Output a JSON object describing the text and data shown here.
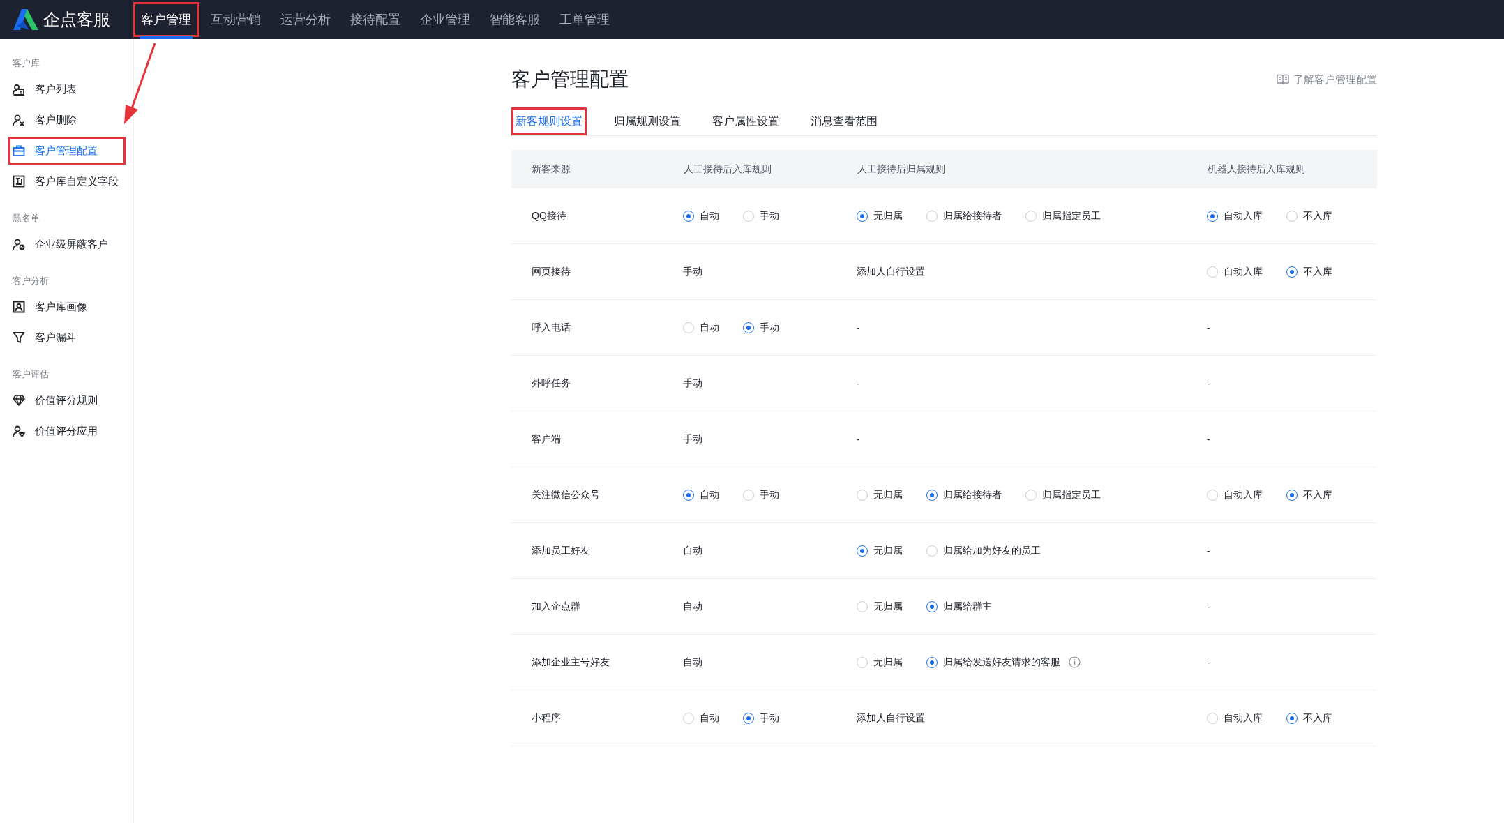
{
  "app": {
    "name": "企点客服"
  },
  "nav": [
    {
      "label": "客户管理",
      "selected": true,
      "annotated": true
    },
    {
      "label": "互动营销",
      "selected": false,
      "annotated": false
    },
    {
      "label": "运营分析",
      "selected": false,
      "annotated": false
    },
    {
      "label": "接待配置",
      "selected": false,
      "annotated": false
    },
    {
      "label": "企业管理",
      "selected": false,
      "annotated": false
    },
    {
      "label": "智能客服",
      "selected": false,
      "annotated": false
    },
    {
      "label": "工单管理",
      "selected": false,
      "annotated": false
    }
  ],
  "sidebar": [
    {
      "heading": "客户库",
      "items": [
        {
          "label": "客户列表",
          "selected": false,
          "annotated": false
        },
        {
          "label": "客户删除",
          "selected": false,
          "annotated": false
        },
        {
          "label": "客户管理配置",
          "selected": true,
          "annotated": true
        },
        {
          "label": "客户库自定义字段",
          "selected": false,
          "annotated": false
        }
      ]
    },
    {
      "heading": "黑名单",
      "items": [
        {
          "label": "企业级屏蔽客户",
          "selected": false,
          "annotated": false
        }
      ]
    },
    {
      "heading": "客户分析",
      "items": [
        {
          "label": "客户库画像",
          "selected": false,
          "annotated": false
        },
        {
          "label": "客户漏斗",
          "selected": false,
          "annotated": false
        }
      ]
    },
    {
      "heading": "客户评估",
      "items": [
        {
          "label": "价值评分规则",
          "selected": false,
          "annotated": false
        },
        {
          "label": "价值评分应用",
          "selected": false,
          "annotated": false
        }
      ]
    }
  ],
  "page": {
    "title": "客户管理配置",
    "help_link": "了解客户管理配置"
  },
  "tabs": [
    {
      "label": "新客规则设置",
      "selected": true,
      "annotated": true
    },
    {
      "label": "归属规则设置",
      "selected": false,
      "annotated": false
    },
    {
      "label": "客户属性设置",
      "selected": false,
      "annotated": false
    },
    {
      "label": "消息查看范围",
      "selected": false,
      "annotated": false
    }
  ],
  "table": {
    "columns": [
      "新客来源",
      "人工接待后入库规则",
      "人工接待后归属规则",
      "机器人接待后入库规则"
    ],
    "rows": [
      {
        "cells": [
          {
            "kind": "text",
            "text": "QQ接待"
          },
          {
            "kind": "radios",
            "options": [
              {
                "label": "自动",
                "selected": true
              },
              {
                "label": "手动",
                "selected": false
              }
            ]
          },
          {
            "kind": "radios",
            "options": [
              {
                "label": "无归属",
                "selected": true
              },
              {
                "label": "归属给接待者",
                "selected": false
              },
              {
                "label": "归属指定员工",
                "selected": false
              }
            ]
          },
          {
            "kind": "radios",
            "options": [
              {
                "label": "自动入库",
                "selected": true
              },
              {
                "label": "不入库",
                "selected": false
              }
            ]
          }
        ]
      },
      {
        "cells": [
          {
            "kind": "text",
            "text": "网页接待"
          },
          {
            "kind": "text",
            "text": "手动"
          },
          {
            "kind": "text",
            "text": "添加人自行设置"
          },
          {
            "kind": "radios",
            "options": [
              {
                "label": "自动入库",
                "selected": false
              },
              {
                "label": "不入库",
                "selected": true
              }
            ]
          }
        ]
      },
      {
        "cells": [
          {
            "kind": "text",
            "text": "呼入电话"
          },
          {
            "kind": "radios",
            "options": [
              {
                "label": "自动",
                "selected": false
              },
              {
                "label": "手动",
                "selected": true
              }
            ]
          },
          {
            "kind": "text",
            "text": "-"
          },
          {
            "kind": "text",
            "text": "-"
          }
        ]
      },
      {
        "cells": [
          {
            "kind": "text",
            "text": "外呼任务"
          },
          {
            "kind": "text",
            "text": "手动"
          },
          {
            "kind": "text",
            "text": "-"
          },
          {
            "kind": "text",
            "text": "-"
          }
        ]
      },
      {
        "cells": [
          {
            "kind": "text",
            "text": "客户端"
          },
          {
            "kind": "text",
            "text": "手动"
          },
          {
            "kind": "text",
            "text": "-"
          },
          {
            "kind": "text",
            "text": "-"
          }
        ]
      },
      {
        "cells": [
          {
            "kind": "text",
            "text": "关注微信公众号"
          },
          {
            "kind": "radios",
            "options": [
              {
                "label": "自动",
                "selected": true
              },
              {
                "label": "手动",
                "selected": false
              }
            ]
          },
          {
            "kind": "radios",
            "options": [
              {
                "label": "无归属",
                "selected": false
              },
              {
                "label": "归属给接待者",
                "selected": true
              },
              {
                "label": "归属指定员工",
                "selected": false
              }
            ]
          },
          {
            "kind": "radios",
            "options": [
              {
                "label": "自动入库",
                "selected": false
              },
              {
                "label": "不入库",
                "selected": true
              }
            ]
          }
        ]
      },
      {
        "cells": [
          {
            "kind": "text",
            "text": "添加员工好友"
          },
          {
            "kind": "text",
            "text": "自动"
          },
          {
            "kind": "radios",
            "options": [
              {
                "label": "无归属",
                "selected": true
              },
              {
                "label": "归属给加为好友的员工",
                "selected": false
              }
            ]
          },
          {
            "kind": "text",
            "text": "-"
          }
        ]
      },
      {
        "cells": [
          {
            "kind": "text",
            "text": "加入企点群"
          },
          {
            "kind": "text",
            "text": "自动"
          },
          {
            "kind": "radios",
            "options": [
              {
                "label": "无归属",
                "selected": false
              },
              {
                "label": "归属给群主",
                "selected": true
              }
            ]
          },
          {
            "kind": "text",
            "text": "-"
          }
        ]
      },
      {
        "cells": [
          {
            "kind": "text",
            "text": "添加企业主号好友"
          },
          {
            "kind": "text",
            "text": "自动"
          },
          {
            "kind": "radios",
            "info_icon": true,
            "options": [
              {
                "label": "无归属",
                "selected": false
              },
              {
                "label": "归属给发送好友请求的客服",
                "selected": true
              }
            ]
          },
          {
            "kind": "text",
            "text": "-"
          }
        ]
      },
      {
        "cells": [
          {
            "kind": "text",
            "text": "小程序"
          },
          {
            "kind": "radios",
            "options": [
              {
                "label": "自动",
                "selected": false
              },
              {
                "label": "手动",
                "selected": true
              }
            ]
          },
          {
            "kind": "text",
            "text": "添加人自行设置"
          },
          {
            "kind": "radios",
            "options": [
              {
                "label": "自动入库",
                "selected": false
              },
              {
                "label": "不入库",
                "selected": true
              }
            ]
          }
        ]
      }
    ]
  }
}
